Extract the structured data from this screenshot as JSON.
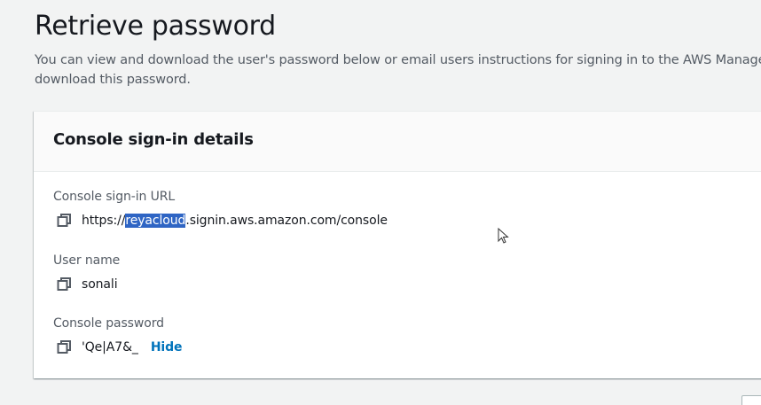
{
  "page": {
    "title": "Retrieve password",
    "description": "You can view and download the user's password below or email users instructions for signing in to the AWS Managemen download this password."
  },
  "card": {
    "title": "Console sign-in details",
    "url": {
      "label": "Console sign-in URL",
      "prefix": "https://",
      "selected": "reyacloud",
      "suffix": ".signin.aws.amazon.com/console",
      "icon": "copy-icon"
    },
    "username": {
      "label": "User name",
      "value": "sonali",
      "icon": "copy-icon"
    },
    "password": {
      "label": "Console password",
      "value": "'Qe|A7&_",
      "hide_label": "Hide",
      "icon": "copy-icon"
    }
  },
  "colors": {
    "background": "#f2f3f3",
    "link": "#0073bb",
    "selection": "#2f65c4"
  }
}
